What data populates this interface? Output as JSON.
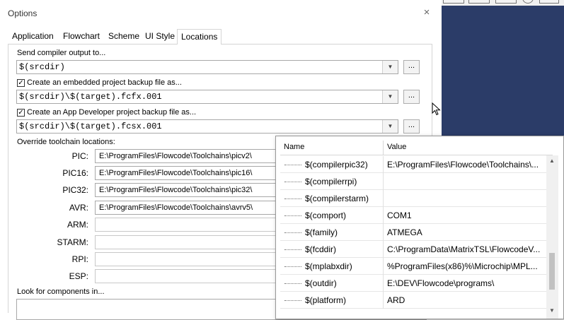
{
  "dialog": {
    "title": "Options",
    "close_glyph": "×"
  },
  "tabs": [
    {
      "label": "Application"
    },
    {
      "label": "Flowchart"
    },
    {
      "label": "Scheme"
    },
    {
      "label": "UI Style"
    },
    {
      "label": "Locations",
      "active": true
    }
  ],
  "locations": {
    "compiler_output": {
      "label": "Send compiler output to...",
      "value": "$(srcdir)"
    },
    "embedded_backup": {
      "label": "Create an embedded project backup file as...",
      "checked": true,
      "value": "$(srcdir)\\$(target).fcfx.001"
    },
    "appdev_backup": {
      "label": "Create an App Developer project backup file as...",
      "checked": true,
      "value": "$(srcdir)\\$(target).fcsx.001"
    },
    "browse_label": "...",
    "dropdown_glyph": "▼",
    "check_glyph": "✓",
    "toolchain_heading": "Override toolchain locations:",
    "toolchains": [
      {
        "label": "PIC:",
        "value": "E:\\ProgramFiles\\Flowcode\\Toolchains\\picv2\\"
      },
      {
        "label": "PIC16:",
        "value": "E:\\ProgramFiles\\Flowcode\\Toolchains\\pic16\\"
      },
      {
        "label": "PIC32:",
        "value": "E:\\ProgramFiles\\Flowcode\\Toolchains\\pic32\\"
      },
      {
        "label": "AVR:",
        "value": "E:\\ProgramFiles\\Flowcode\\Toolchains\\avrv5\\"
      },
      {
        "label": "ARM:",
        "value": ""
      },
      {
        "label": "STARM:",
        "value": ""
      },
      {
        "label": "RPI:",
        "value": ""
      },
      {
        "label": "ESP:",
        "value": ""
      }
    ],
    "components_heading": "Look for components in..."
  },
  "macro_popup": {
    "columns": {
      "name": "Name",
      "value": "Value"
    },
    "rows": [
      {
        "name": "$(compilerpic32)",
        "value": "E:\\ProgramFiles\\Flowcode\\Toolchains\\..."
      },
      {
        "name": "$(compilerrpi)",
        "value": ""
      },
      {
        "name": "$(compilerstarm)",
        "value": ""
      },
      {
        "name": "$(comport)",
        "value": "COM1"
      },
      {
        "name": "$(family)",
        "value": "ATMEGA"
      },
      {
        "name": "$(fcddir)",
        "value": "C:\\ProgramData\\MatrixTSL\\FlowcodeV..."
      },
      {
        "name": "$(mplabxdir)",
        "value": "%ProgramFiles(x86)%\\Microchip\\MPL..."
      },
      {
        "name": "$(outdir)",
        "value": "E:\\DEV\\Flowcode\\programs\\"
      },
      {
        "name": "$(platform)",
        "value": "ARD"
      }
    ],
    "scroll_up_glyph": "▲",
    "scroll_down_glyph": "▼"
  },
  "colors": {
    "background_right": "#2b3c68",
    "dialog_bg": "#ffffff",
    "border": "#a8a8a8"
  }
}
